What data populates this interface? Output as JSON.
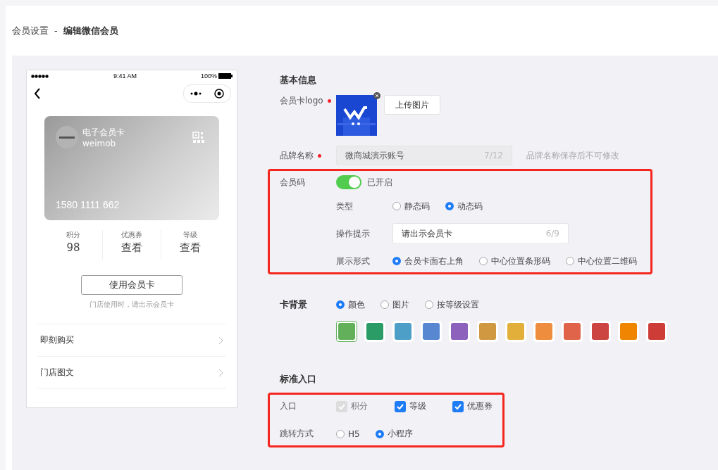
{
  "breadcrumb": {
    "parent": "会员设置",
    "separator": "-",
    "current": "编辑微信会员"
  },
  "phone": {
    "time": "9:41 AM",
    "battery": "100%",
    "card": {
      "title": "电子会员卡",
      "subtitle": "weimob",
      "number": "1580 1111 662"
    },
    "stats": [
      {
        "label": "积分",
        "value": "98"
      },
      {
        "label": "优惠券",
        "value": "查看"
      },
      {
        "label": "等级",
        "value": "查看"
      }
    ],
    "use_button": "使用会员卡",
    "hint": "门店使用时，请出示会员卡",
    "menu": [
      {
        "label": "即刻购买"
      },
      {
        "label": "门店图文"
      }
    ]
  },
  "basic": {
    "heading": "基本信息",
    "logo": {
      "label": "会员卡logo",
      "required": true,
      "upload": "上传图片"
    },
    "brand": {
      "label": "品牌名称",
      "required": true,
      "value": "微商城演示账号",
      "count": "7/12",
      "note": "品牌名称保存后不可修改"
    }
  },
  "member_code": {
    "highlighted": true,
    "label": "会员码",
    "on": true,
    "status": "已开启",
    "type": {
      "label": "类型",
      "options": [
        {
          "label": "静态码",
          "selected": false
        },
        {
          "label": "动态码",
          "selected": true
        }
      ]
    },
    "tip": {
      "label": "操作提示",
      "value": "请出示会员卡",
      "count": "6/9"
    },
    "display": {
      "label": "展示形式",
      "options": [
        {
          "label": "会员卡面右上角",
          "selected": true
        },
        {
          "label": "中心位置条形码",
          "selected": false
        },
        {
          "label": "中心位置二维码",
          "selected": false
        }
      ]
    }
  },
  "background": {
    "label": "卡背景",
    "options": [
      {
        "label": "颜色",
        "selected": true
      },
      {
        "label": "图片",
        "selected": false
      },
      {
        "label": "按等级设置",
        "selected": false
      }
    ],
    "swatches": [
      {
        "color": "#62b15a",
        "selected": true
      },
      {
        "color": "#2b9c65",
        "selected": false
      },
      {
        "color": "#4e9fc8",
        "selected": false
      },
      {
        "color": "#5887d2",
        "selected": false
      },
      {
        "color": "#8c62bc",
        "selected": false
      },
      {
        "color": "#d09841",
        "selected": false
      },
      {
        "color": "#e2b03a",
        "selected": false
      },
      {
        "color": "#ed8d3d",
        "selected": false
      },
      {
        "color": "#df6449",
        "selected": false
      },
      {
        "color": "#cc4540",
        "selected": false
      },
      {
        "color": "#ef8500",
        "selected": false
      },
      {
        "color": "#cd3c37",
        "selected": false
      }
    ]
  },
  "entry": {
    "heading": "标准入口",
    "highlighted": true,
    "entries": {
      "label": "入口",
      "items": [
        {
          "label": "积分",
          "checked": true,
          "disabled": true
        },
        {
          "label": "等级",
          "checked": true,
          "disabled": false
        },
        {
          "label": "优惠券",
          "checked": true,
          "disabled": false
        }
      ]
    },
    "jump": {
      "label": "跳转方式",
      "options": [
        {
          "label": "H5",
          "selected": false
        },
        {
          "label": "小程序",
          "selected": true
        }
      ]
    }
  }
}
